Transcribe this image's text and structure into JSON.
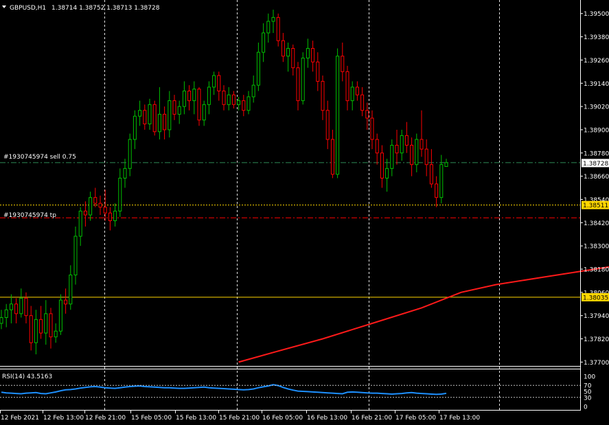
{
  "header": {
    "symbol": "GBPUSD,H1",
    "quote": "1.38714 1.38752 1.38713 1.38728"
  },
  "orders": {
    "sell_label": "#1930745974 sell 0.75",
    "tp_label": "#1930745974 tp"
  },
  "price_axis": {
    "ticks": [
      "1.39500",
      "1.39380",
      "1.39260",
      "1.39140",
      "1.39020",
      "1.38900",
      "1.38780",
      "1.38660",
      "1.38540",
      "1.38420",
      "1.38300",
      "1.38180",
      "1.38060",
      "1.37940",
      "1.37820",
      "1.37700"
    ]
  },
  "price_tags": {
    "current": "1.38728",
    "yellow1": "1.38511",
    "yellow2": "1.38035"
  },
  "rsi": {
    "label": "RSI(14) 43.5163",
    "ticks": [
      "100",
      "70",
      "50",
      "30",
      "0"
    ]
  },
  "time_axis": {
    "labels": [
      "12 Feb 2021",
      "12 Feb 13:00",
      "12 Feb 21:00",
      "15 Feb 05:00",
      "15 Feb 13:00",
      "15 Feb 21:00",
      "16 Feb 05:00",
      "16 Feb 13:00",
      "16 Feb 21:00",
      "17 Feb 05:00",
      "17 Feb 13:00"
    ]
  },
  "colors": {
    "background": "#000000",
    "bull": "#00c000",
    "bear": "#ff0000",
    "ma": "#ff1a1a",
    "rsi": "#1e90ff",
    "grid": "#ffffff",
    "yellow": "#ffd700",
    "order_green": "#2e8b57",
    "order_red": "#ff0000"
  },
  "chart_data": {
    "type": "candlestick",
    "symbol": "GBPUSD",
    "timeframe": "H1",
    "ylim": [
      1.3768,
      1.3957
    ],
    "candles": [
      [
        1.379,
        1.3797,
        1.3787,
        1.3793
      ],
      [
        1.3793,
        1.38,
        1.3788,
        1.3797
      ],
      [
        1.3797,
        1.3805,
        1.379,
        1.38
      ],
      [
        1.38,
        1.3803,
        1.379,
        1.3795
      ],
      [
        1.3795,
        1.3808,
        1.3793,
        1.3803
      ],
      [
        1.3803,
        1.3806,
        1.379,
        1.3794
      ],
      [
        1.3794,
        1.3799,
        1.3776,
        1.378
      ],
      [
        1.378,
        1.3797,
        1.3774,
        1.3792
      ],
      [
        1.3792,
        1.3799,
        1.3782,
        1.3785
      ],
      [
        1.3785,
        1.3802,
        1.3779,
        1.3795
      ],
      [
        1.3795,
        1.3798,
        1.3777,
        1.3783
      ],
      [
        1.3783,
        1.379,
        1.378,
        1.3786
      ],
      [
        1.3786,
        1.3805,
        1.3784,
        1.3802
      ],
      [
        1.3802,
        1.3808,
        1.3795,
        1.38
      ],
      [
        1.38,
        1.382,
        1.3797,
        1.3815
      ],
      [
        1.3815,
        1.384,
        1.381,
        1.3835
      ],
      [
        1.3835,
        1.385,
        1.383,
        1.3848
      ],
      [
        1.3848,
        1.3853,
        1.384,
        1.3846
      ],
      [
        1.3846,
        1.3858,
        1.3843,
        1.3855
      ],
      [
        1.3855,
        1.386,
        1.385,
        1.3852
      ],
      [
        1.3852,
        1.3856,
        1.3846,
        1.385
      ],
      [
        1.385,
        1.3859,
        1.3843,
        1.3847
      ],
      [
        1.3847,
        1.385,
        1.3838,
        1.3843
      ],
      [
        1.3843,
        1.3852,
        1.384,
        1.3848
      ],
      [
        1.3848,
        1.387,
        1.3845,
        1.3865
      ],
      [
        1.3865,
        1.3875,
        1.386,
        1.387
      ],
      [
        1.387,
        1.3888,
        1.3866,
        1.3885
      ],
      [
        1.3885,
        1.39,
        1.388,
        1.3897
      ],
      [
        1.3897,
        1.3905,
        1.3892,
        1.39
      ],
      [
        1.39,
        1.3903,
        1.389,
        1.3893
      ],
      [
        1.3893,
        1.3906,
        1.389,
        1.3903
      ],
      [
        1.3903,
        1.3905,
        1.3887,
        1.3889
      ],
      [
        1.3889,
        1.3912,
        1.3885,
        1.3898
      ],
      [
        1.3898,
        1.3902,
        1.3885,
        1.389
      ],
      [
        1.389,
        1.391,
        1.3886,
        1.3905
      ],
      [
        1.3905,
        1.3908,
        1.3895,
        1.3898
      ],
      [
        1.3898,
        1.3905,
        1.3893,
        1.3902
      ],
      [
        1.3902,
        1.3915,
        1.3898,
        1.391
      ],
      [
        1.391,
        1.3913,
        1.39,
        1.3905
      ],
      [
        1.3905,
        1.3915,
        1.3898,
        1.3911
      ],
      [
        1.3911,
        1.3912,
        1.3892,
        1.3895
      ],
      [
        1.3895,
        1.3905,
        1.3892,
        1.3903
      ],
      [
        1.3903,
        1.3915,
        1.3898,
        1.3912
      ],
      [
        1.3912,
        1.392,
        1.3908,
        1.3918
      ],
      [
        1.3918,
        1.392,
        1.3905,
        1.391
      ],
      [
        1.391,
        1.3913,
        1.39,
        1.3903
      ],
      [
        1.3903,
        1.3912,
        1.39,
        1.3908
      ],
      [
        1.3908,
        1.391,
        1.3901,
        1.3903
      ],
      [
        1.3903,
        1.3907,
        1.39,
        1.3905
      ],
      [
        1.3905,
        1.3908,
        1.3897,
        1.39
      ],
      [
        1.39,
        1.391,
        1.3898,
        1.3907
      ],
      [
        1.3907,
        1.3918,
        1.3904,
        1.3913
      ],
      [
        1.3913,
        1.3935,
        1.391,
        1.393
      ],
      [
        1.393,
        1.3945,
        1.3925,
        1.394
      ],
      [
        1.394,
        1.395,
        1.3935,
        1.3946
      ],
      [
        1.3946,
        1.3952,
        1.394,
        1.3948
      ],
      [
        1.3948,
        1.395,
        1.3933,
        1.3936
      ],
      [
        1.3936,
        1.394,
        1.3925,
        1.3928
      ],
      [
        1.3928,
        1.3935,
        1.392,
        1.3932
      ],
      [
        1.3932,
        1.3934,
        1.3918,
        1.3922
      ],
      [
        1.3922,
        1.3925,
        1.39,
        1.3905
      ],
      [
        1.3905,
        1.393,
        1.3903,
        1.3927
      ],
      [
        1.3927,
        1.3937,
        1.3922,
        1.3932
      ],
      [
        1.3932,
        1.3936,
        1.392,
        1.3925
      ],
      [
        1.3925,
        1.393,
        1.391,
        1.3915
      ],
      [
        1.3915,
        1.3918,
        1.3895,
        1.39
      ],
      [
        1.39,
        1.3905,
        1.388,
        1.3885
      ],
      [
        1.3885,
        1.389,
        1.3865,
        1.3867
      ],
      [
        1.3867,
        1.3932,
        1.3865,
        1.3928
      ],
      [
        1.3928,
        1.3935,
        1.3915,
        1.392
      ],
      [
        1.392,
        1.3923,
        1.39,
        1.3905
      ],
      [
        1.3905,
        1.3915,
        1.39,
        1.3912
      ],
      [
        1.3912,
        1.3915,
        1.3905,
        1.3908
      ],
      [
        1.3908,
        1.3912,
        1.3897,
        1.39
      ],
      [
        1.39,
        1.3904,
        1.389,
        1.3896
      ],
      [
        1.3896,
        1.39,
        1.388,
        1.3885
      ],
      [
        1.3885,
        1.3888,
        1.3872,
        1.3878
      ],
      [
        1.3878,
        1.3882,
        1.386,
        1.3865
      ],
      [
        1.3865,
        1.3875,
        1.3858,
        1.387
      ],
      [
        1.387,
        1.3885,
        1.3866,
        1.3882
      ],
      [
        1.3882,
        1.389,
        1.3872,
        1.3878
      ],
      [
        1.3878,
        1.389,
        1.3874,
        1.3887
      ],
      [
        1.3887,
        1.3894,
        1.3878,
        1.3882
      ],
      [
        1.3882,
        1.3886,
        1.3866,
        1.3872
      ],
      [
        1.3872,
        1.3888,
        1.3868,
        1.3885
      ],
      [
        1.3885,
        1.39,
        1.3876,
        1.388
      ],
      [
        1.388,
        1.3885,
        1.3866,
        1.3872
      ],
      [
        1.3872,
        1.388,
        1.386,
        1.3862
      ],
      [
        1.3862,
        1.3866,
        1.385,
        1.3855
      ],
      [
        1.3855,
        1.3877,
        1.3852,
        1.3872
      ],
      [
        1.3871,
        1.3875,
        1.3871,
        1.3873
      ]
    ],
    "moving_average": {
      "points": [
        [
          48,
          1.377
        ],
        [
          55,
          1.3775
        ],
        [
          65,
          1.3782
        ],
        [
          75,
          1.379
        ],
        [
          85,
          1.3798
        ],
        [
          93,
          1.3806
        ],
        [
          100,
          1.381
        ],
        [
          110,
          1.3814
        ],
        [
          120,
          1.3818
        ],
        [
          130,
          1.3822
        ],
        [
          136,
          1.3824
        ]
      ]
    },
    "horizontal_lines": {
      "sell_order": 1.3873,
      "take_profit": 1.38445,
      "yellow1": 1.38511,
      "yellow2": 1.38035
    },
    "rsi": {
      "period": 14,
      "last": 43.5163,
      "ylim": [
        0,
        100
      ],
      "levels": [
        70,
        30
      ],
      "values": [
        47,
        45,
        44,
        43,
        42,
        44,
        45,
        46,
        43,
        42,
        45,
        48,
        52,
        55,
        56,
        58,
        61,
        63,
        65,
        66,
        64,
        62,
        61,
        60,
        62,
        64,
        66,
        67,
        68,
        66,
        65,
        64,
        63,
        62,
        62,
        61,
        60,
        60,
        61,
        62,
        63,
        64,
        62,
        61,
        60,
        59,
        58,
        57,
        56,
        55,
        56,
        58,
        62,
        65,
        68,
        72,
        69,
        63,
        58,
        54,
        51,
        50,
        49,
        48,
        47,
        46,
        45,
        44,
        43,
        42,
        47,
        48,
        47,
        46,
        45,
        44,
        44,
        43,
        42,
        41,
        42,
        43,
        45,
        46,
        44,
        43,
        42,
        41,
        40,
        41,
        43.5
      ]
    }
  }
}
